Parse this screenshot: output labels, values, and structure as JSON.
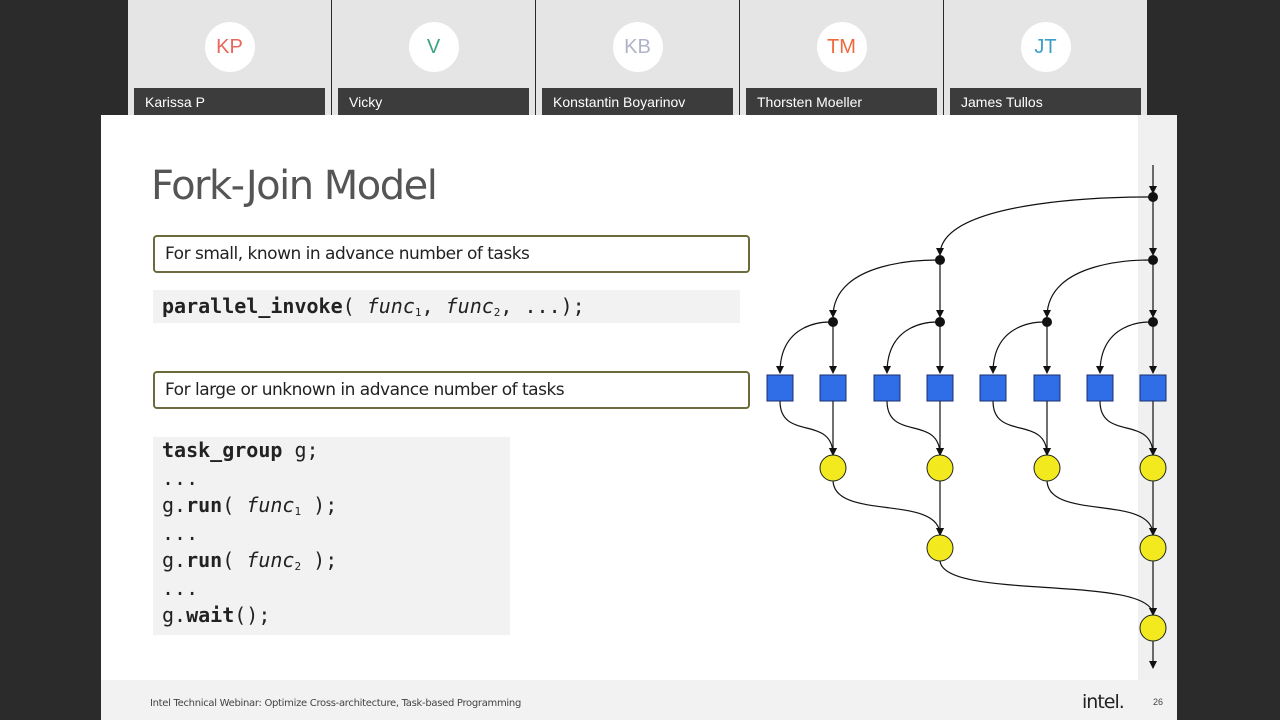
{
  "participants": [
    {
      "initials": "KP",
      "name": "Karissa P",
      "color": "#e8665a"
    },
    {
      "initials": "V",
      "name": "Vicky",
      "color": "#3aa57a"
    },
    {
      "initials": "KB",
      "name": "Konstantin Boyarinov",
      "color": "#b0b3c8"
    },
    {
      "initials": "TM",
      "name": "Thorsten Moeller",
      "color": "#ee6a3c"
    },
    {
      "initials": "JT",
      "name": "James Tullos",
      "color": "#3a9fc9"
    }
  ],
  "slide": {
    "title": "Fork-Join Model",
    "box1": "For small, known in advance number of tasks",
    "code1": {
      "fn": "parallel_invoke",
      "open": "( ",
      "arg": "func",
      "sub1": "1",
      "sep": ", ",
      "sub2": "2",
      "tail": ", ...);"
    },
    "box2": "For large or unknown in advance number of tasks",
    "code2": {
      "decl_kw": "task_group",
      "decl_rest": " g;",
      "ellipsis": "...",
      "obj": "g.",
      "run": "run",
      "run_open": "( ",
      "arg": "func",
      "sub1": "1",
      "sub2": "2",
      "run_close": " );",
      "wait": "wait",
      "wait_rest": "();"
    },
    "footer": "Intel Technical Webinar: Optimize Cross-architecture, Task-based Programming",
    "logo": "intel.",
    "page": "26"
  },
  "colors": {
    "task_box": "#2f6ee6",
    "join_node": "#f2ea1e"
  }
}
